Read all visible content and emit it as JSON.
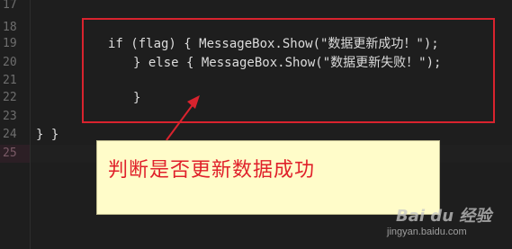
{
  "editor": {
    "line_numbers": [
      "17",
      "18",
      "19",
      "20",
      "21",
      "22",
      "23",
      "24",
      "25"
    ],
    "lines": {
      "19": "if (flag) { MessageBox.Show(\"数据更新成功！\");",
      "20": "} else { MessageBox.Show(\"数据更新失败！\");",
      "22": "}",
      "24": "} }"
    }
  },
  "annotation": {
    "text": "判断是否更新数据成功",
    "box_color": "#d9232e",
    "note_background": "#fffcc9"
  },
  "watermark": {
    "logo": "Bai du 经验",
    "url": "jingyan.baidu.com"
  }
}
